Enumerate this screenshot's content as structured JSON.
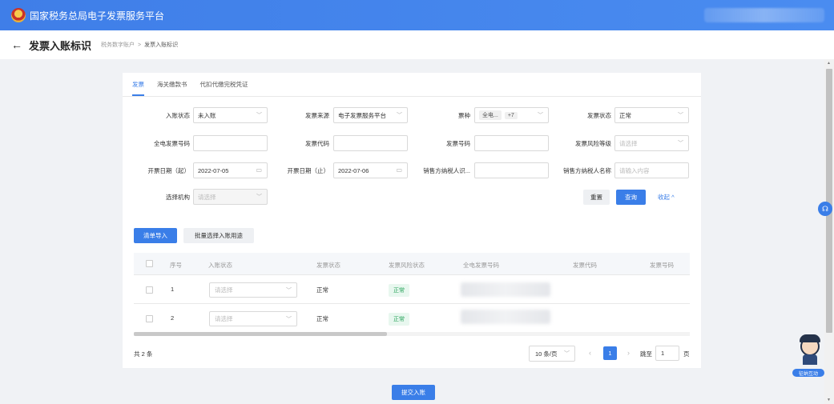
{
  "app": {
    "platform_title": "国家税务总局电子发票服务平台"
  },
  "header": {
    "back_icon": "←",
    "title": "发票入账标识",
    "breadcrumb": [
      "税务数字账户",
      "发票入账标识"
    ],
    "separator": ">"
  },
  "tabs": [
    {
      "label": "发票",
      "active": true
    },
    {
      "label": "海关缴款书",
      "active": false
    },
    {
      "label": "代扣代缴完税凭证",
      "active": false
    }
  ],
  "filters": {
    "entry_status": {
      "label": "入账状态",
      "value": "未入账"
    },
    "invoice_source": {
      "label": "发票来源",
      "value": "电子发票服务平台"
    },
    "invoice_type": {
      "label": "票种",
      "tag": "全电...",
      "more": "+7"
    },
    "invoice_status": {
      "label": "发票状态",
      "value": "正常"
    },
    "full_invoice_no": {
      "label": "全电发票号码",
      "value": ""
    },
    "invoice_code": {
      "label": "发票代码",
      "value": ""
    },
    "invoice_number": {
      "label": "发票号码",
      "value": ""
    },
    "risk_level": {
      "label": "发票风险等级",
      "placeholder": "请选择"
    },
    "date_start": {
      "label": "开票日期（起）",
      "value": "2022-07-05"
    },
    "date_end": {
      "label": "开票日期（止）",
      "value": "2022-07-06"
    },
    "seller_tax_id": {
      "label": "销售方纳税人识...",
      "value": ""
    },
    "seller_name": {
      "label": "销售方纳税人名称",
      "placeholder": "请输入内容"
    },
    "org": {
      "label": "选择机构",
      "placeholder": "请选择"
    }
  },
  "actions": {
    "reset": "重置",
    "query": "查询",
    "collapse": "收起 ^",
    "import": "清单导入",
    "batch": "批量选择入账用途",
    "submit": "提交入账"
  },
  "table": {
    "columns": [
      "序号",
      "入账状态",
      "发票状态",
      "发票风险状态",
      "全电发票号码",
      "发票代码",
      "发票号码"
    ],
    "rows": [
      {
        "index": "1",
        "entry_placeholder": "请选择",
        "status": "正常",
        "risk": "正常"
      },
      {
        "index": "2",
        "entry_placeholder": "请选择",
        "status": "正常",
        "risk": "正常"
      }
    ]
  },
  "pagination": {
    "total": "共 2 条",
    "page_size": "10 条/页",
    "current": "1",
    "jump_label": "跳至",
    "jump_value": "1",
    "page_suffix": "页"
  },
  "assistant": {
    "label": "征纳互动"
  }
}
